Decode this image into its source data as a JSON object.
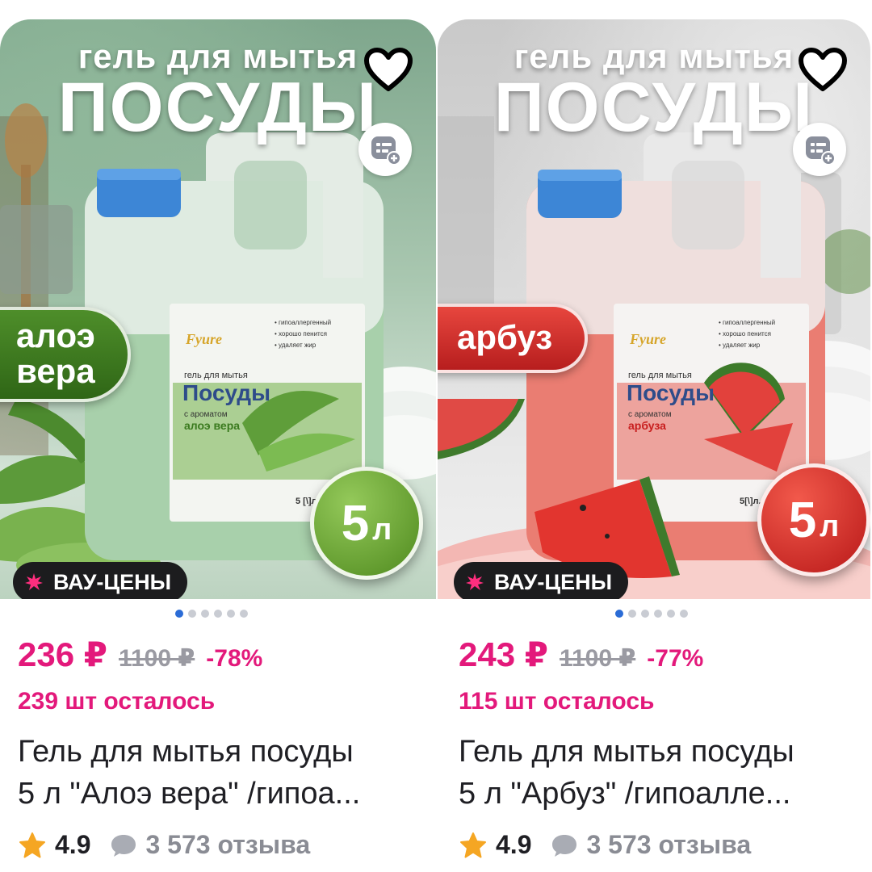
{
  "products": [
    {
      "headline_small": "гель для мытья",
      "headline_big": "ПОСУДЫ",
      "flavor_badge": [
        "алоэ",
        "вера"
      ],
      "volume_number": "5",
      "volume_unit": "л",
      "label_brand": "Fyure",
      "label_line1": "гель для мытья",
      "label_line2": "Посуды",
      "label_aroma1": "с ароматом",
      "label_aroma2": "алоэ вера",
      "label_features": [
        "• гипоаллергенный",
        "• хорошо пенится",
        "• удаляет жир"
      ],
      "label_volume": "5 [\\]л.",
      "promo": "ВАУ-ЦЕНЫ",
      "price_current": "236 ₽",
      "price_old": "1100 ₽",
      "discount": "-78%",
      "stock": "239 шт осталось",
      "title_line1": "Гель для мытья посуды",
      "title_line2": "5 л \"Алоэ вера\" /гипоа...",
      "rating": "4.9",
      "reviews": "3 573 отзыва",
      "colors": {
        "liquid": "#9fc9a3",
        "cap": "#3d86d6",
        "accent": "#4a8a22"
      }
    },
    {
      "headline_small": "гель для мытья",
      "headline_big": "ПОСУДЫ",
      "flavor_badge": [
        "арбуз"
      ],
      "volume_number": "5",
      "volume_unit": "л",
      "label_brand": "Fyure",
      "label_line1": "гель для мытья",
      "label_line2": "Посуды",
      "label_aroma1": "с ароматом",
      "label_aroma2": "арбуза",
      "label_features": [
        "• гипоаллергенный",
        "• хорошо пенится",
        "• удаляет жир"
      ],
      "label_volume": "5[\\]л.",
      "promo": "ВАУ-ЦЕНЫ",
      "price_current": "243 ₽",
      "price_old": "1100 ₽",
      "discount": "-77%",
      "stock": "115 шт осталось",
      "title_line1": "Гель для мытья посуды",
      "title_line2": "5 л \"Арбуз\" /гипоалле...",
      "rating": "4.9",
      "reviews": "3 573 отзыва",
      "colors": {
        "liquid": "#e97b70",
        "cap": "#3d86d6",
        "accent": "#c81e1e"
      }
    }
  ],
  "gallery": {
    "total_dots": 6,
    "active_dot": 1
  },
  "icons": {
    "favorite": "heart-outline-icon",
    "compare": "compare-add-icon",
    "promo": "starburst-icon",
    "rating": "star-icon",
    "reviews": "comment-bubble-icon"
  },
  "colors": {
    "price": "#e3197b",
    "muted": "#9a9aa2",
    "active_dot": "#2b6cd6",
    "star": "#f5a623"
  }
}
